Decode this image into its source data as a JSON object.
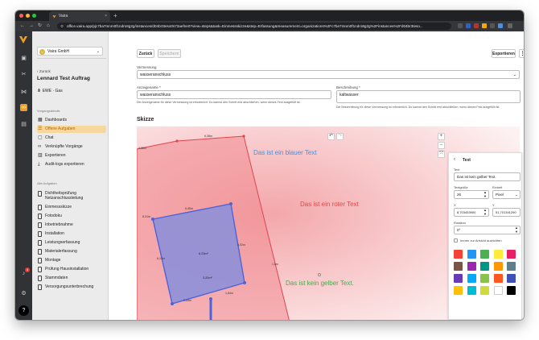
{
  "browser": {
    "tab_title": "Vaira",
    "url": "office.vaira.app/pjc7ba7mnm0f1ndro8g2g/instances/d04br3teso0s73aefne0?view=steps&task=Einmessskizze&step=Erfassung&measurement=organizations%2Fc7be7mnm0f1ndro8g2g%2Finstances%2Fd04br3teso..."
  },
  "sidebar": {
    "org_name": "Vaira GmbH",
    "back_label": "Zurück",
    "project_title": "Lennard Test Auftrag",
    "project_sub": "EWE · Gas",
    "section_process": "Vorgangsdetails",
    "nav": [
      {
        "label": "Dashboards"
      },
      {
        "label": "Offene Aufgaben"
      },
      {
        "label": "Chat"
      },
      {
        "label": "Verknüpfte Vorgänge"
      },
      {
        "label": "Exportieren"
      },
      {
        "label": "Audit-logs exportieren"
      }
    ],
    "section_tasks": "Alle Aufgaben",
    "tasks": [
      "Dichtheitsprüfung Netzanschlussleitung",
      "Einmessskizze",
      "Fotodoku",
      "Inbetriebnahme",
      "Installation",
      "Leistungserfassung",
      "Materialerfassung",
      "Montage",
      "Prüfung Hausinstallation",
      "Stammdaten",
      "Versorgungsunterbrechung"
    ],
    "notification_count": "4"
  },
  "toolbar": {
    "back": "Zurück",
    "save": "Speichern",
    "export": "Exportieren"
  },
  "form": {
    "measurement_label": "Vermessung",
    "measurement_value": "wasseranschluss",
    "display_name_label": "Anzeigename *",
    "display_name_value": "wasseranschluss",
    "display_name_hint": "Der Anzeigename für diese Vermessung ist erforderlich. Du kannst den Schritt erst abschließen, wenn dieses Feld ausgefüllt ist.",
    "description_label": "Beschreibung *",
    "description_value": "kaltwasser",
    "description_hint": "Die Beschreibung für diese Vermessung ist erforderlich. Du kannst den Schritt erst abschließen, wenn dieses Feld ausgefüllt ist."
  },
  "sketch": {
    "title": "Skizze",
    "texts": {
      "blue": "Das ist ein blauer Text",
      "red": "Das ist ein roter Text",
      "yellow": "Das ist kein gelber Text."
    },
    "measures": {
      "top_a": "4,36m",
      "top_b": "6,38m",
      "left": "8,31m",
      "rect_top": "6,45m",
      "rect_left": "6,13m",
      "rect_right": "5,02m",
      "rect_bottom": "2,44m",
      "rect_bottom2": "1,64m",
      "area1": "6,23m²",
      "area2": "3,20m²",
      "right_edge": "1,5m"
    },
    "colors": {
      "blue_text": "#4a8fd8",
      "red_text": "#e04848",
      "green_text": "#4caa4c",
      "outline": "#e2434d",
      "polygon": "#5566c8"
    }
  },
  "text_panel": {
    "title": "Text",
    "text_label": "Text",
    "text_value": "Das ist kein gelber Text.",
    "size_label": "Textgröße",
    "size_value": "26",
    "unit_label": "Einheit",
    "unit_value": "Pixel",
    "x_label": "X",
    "x_value": "8,703453900",
    "y_label": "Y",
    "y_value": "51,701341290",
    "rotation_label": "Rotation",
    "rotation_value": "0°",
    "always_view_label": "Immer zur Ansicht ausrichten",
    "swatches": [
      "#f44336",
      "#2196f3",
      "#4caf50",
      "#ffeb3b",
      "#e91e63",
      "#795548",
      "#9c27b0",
      "#009688",
      "#ff9800",
      "#607d8b",
      "#673ab7",
      "#03a9f4",
      "#8bc34a",
      "#ff5722",
      "#3f51b5",
      "#ffc107",
      "#00bcd4",
      "#cddc39",
      "#ffffff",
      "#000000"
    ]
  }
}
